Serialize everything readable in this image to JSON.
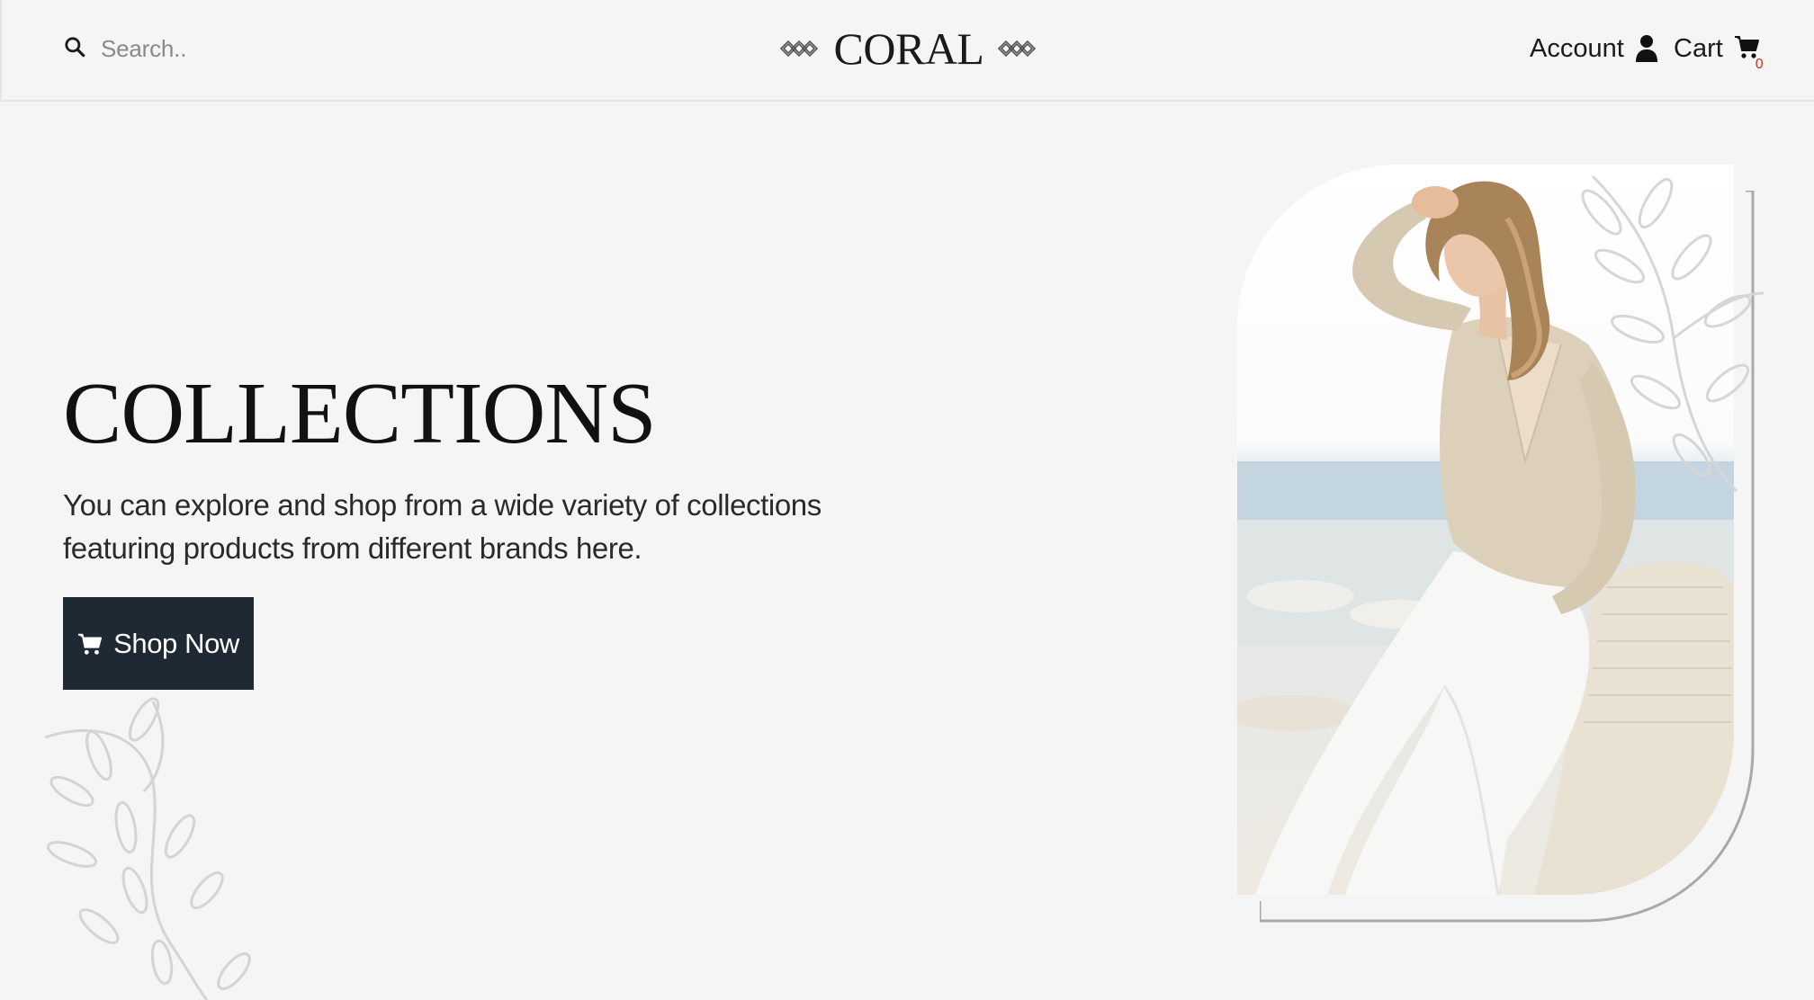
{
  "header": {
    "search": {
      "placeholder": "Search..",
      "value": ""
    },
    "logo": {
      "text": "CORAL"
    },
    "account_label": "Account",
    "cart_label": "Cart",
    "cart_count": "0"
  },
  "hero": {
    "title": "COLLECTIONS",
    "description": "You can explore and shop from a wide variety of collections featuring products from different brands here.",
    "button_label": "Shop Now"
  },
  "colors": {
    "background": "#f5f5f5",
    "button_bg": "#1f2933",
    "badge": "#c0392b"
  },
  "icons": [
    "search-icon",
    "logo-diamond-icon",
    "user-icon",
    "cart-icon",
    "shopping-cart-icon"
  ]
}
